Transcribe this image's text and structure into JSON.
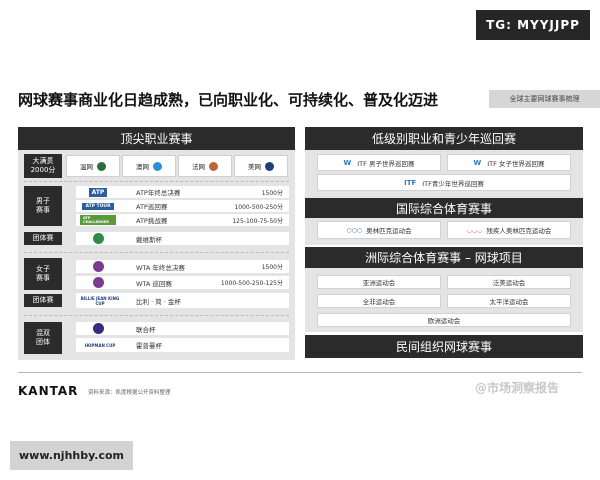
{
  "watermark_top": "TG: MYYJJPP",
  "title": "网球赛事商业化日趋成熟，已向职业化、可持续化、普及化迈进",
  "corner_label": "全球主要网球赛事梳理",
  "left": {
    "header": "顶尖职业赛事",
    "grand_slam_label": "大满贯\n2000分",
    "grand_slams": [
      {
        "name": "温网",
        "color": "#2e6b3a"
      },
      {
        "name": "澳网",
        "color": "#2a8fd4"
      },
      {
        "name": "法网",
        "color": "#b8683a"
      },
      {
        "name": "美网",
        "color": "#1f3f7a"
      }
    ],
    "men_label": "男子\n赛事",
    "men_rows": [
      {
        "logo": "ATP",
        "name": "ATP年终总决赛",
        "points": "1500分"
      },
      {
        "logo": "ATP TOUR",
        "name": "ATP巡回赛",
        "points": "1000-500-250分"
      },
      {
        "logo": "ATP CHALLENGER",
        "name": "ATP挑战赛",
        "points": "125-100-75-50分"
      }
    ],
    "men_team_label": "团体赛",
    "men_team": {
      "name": "戴维斯杯"
    },
    "women_label": "女子\n赛事",
    "women_rows": [
      {
        "name": "WTA 年终总决赛",
        "points": "1500分"
      },
      {
        "name": "WTA 巡回赛",
        "points": "1000-500-250-125分"
      }
    ],
    "women_team_label": "团体赛",
    "women_team": {
      "logo": "BILLIE JEAN KING CUP",
      "name": "比利 · 简 · 金杯"
    },
    "mixed_label": "混双\n团体",
    "mixed_rows": [
      {
        "name": "联合杯"
      },
      {
        "logo": "HOPMAN CUP",
        "name": "霍普曼杯"
      }
    ]
  },
  "right": {
    "header1": "低级别职业和青少年巡回赛",
    "itf": [
      "ITF 男子世界巡回赛",
      "ITF 女子世界巡回赛",
      "ITF青少年世界巡回赛"
    ],
    "header2": "国际综合体育赛事",
    "olympics": [
      "奥林匹克运动会",
      "残疾人奥林匹克运动会"
    ],
    "header3": "洲际综合体育赛事 – 网球项目",
    "continental": [
      "亚洲运动会",
      "泛美运动会",
      "全非运动会",
      "太平洋运动会",
      "欧洲运动会"
    ],
    "header4": "民间组织网球赛事"
  },
  "footer": {
    "brand": "KANTAR",
    "source": "资料来源：凯度根据公开资料整理",
    "watermark": "@市场洞察报告",
    "watermark_bottom": "www.njhhby.com"
  }
}
